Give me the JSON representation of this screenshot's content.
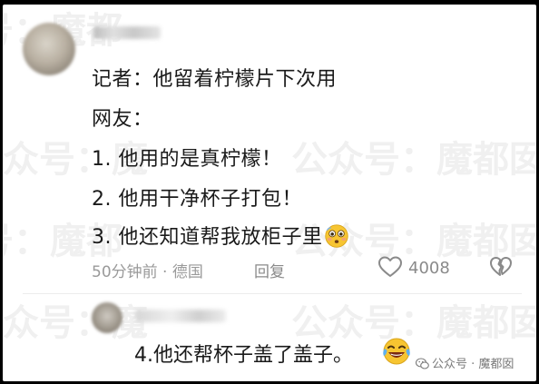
{
  "watermark": {
    "text_a": "公众号：魔都囡",
    "text_b": "公众号：魔都囡",
    "text_c": "号：魔都",
    "text_d": "公众号：魔",
    "text_e": "号：魔都"
  },
  "comment": {
    "lines": [
      "记者：他留着柠檬片下次用",
      "网友：",
      "1. 他用的是真柠檬！",
      "2. 他用干净杯子打包！",
      "3. 他还知道帮我放柜子里"
    ],
    "line3_emoji": "flushed-face-emoji",
    "meta": "50分钟前 · 德国",
    "reply_label": "回复",
    "like_count": "4008",
    "like_icon": "heart-outline-icon",
    "dislike_icon": "broken-heart-icon"
  },
  "reply": {
    "text": "4.他还帮杯子盖了盖子。",
    "emoji": "laughing-tears-emoji"
  },
  "source": {
    "icon": "wechat-icon",
    "text": "公众号 · 魔都囡"
  },
  "colors": {
    "text": "#1a1a1a",
    "meta": "#9a9a9a",
    "emoji_yellow": "#f7c531"
  }
}
